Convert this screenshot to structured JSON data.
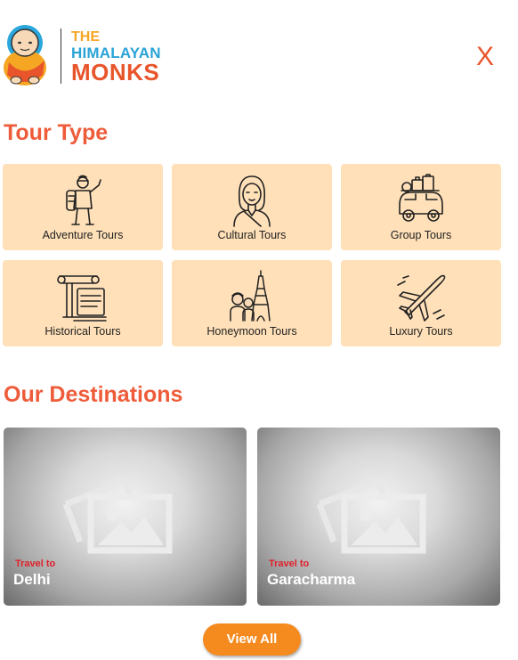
{
  "header": {
    "logo": {
      "line1": "THE",
      "line2": "HIMALAYAN",
      "line3": "MONKS"
    },
    "close_label": "X"
  },
  "tour_type": {
    "title": "Tour Type",
    "items": [
      {
        "label": "Adventure Tours",
        "icon": "hiker-icon"
      },
      {
        "label": "Cultural Tours",
        "icon": "woman-portrait-icon"
      },
      {
        "label": "Group Tours",
        "icon": "car-luggage-icon"
      },
      {
        "label": "Historical Tours",
        "icon": "scroll-column-icon"
      },
      {
        "label": "Honeymoon Tours",
        "icon": "couple-eiffel-icon"
      },
      {
        "label": "Luxury Tours",
        "icon": "airplane-icon"
      }
    ]
  },
  "destinations": {
    "title": "Our Destinations",
    "items": [
      {
        "prefix": "Travel to",
        "name": "Delhi"
      },
      {
        "prefix": "Travel to",
        "name": "Garacharma"
      }
    ],
    "view_all_label": "View All"
  },
  "colors": {
    "accent": "#ee5c3a",
    "card_bg": "#ffe0b8",
    "button": "#f58a1f",
    "travel_to": "#e0202a"
  }
}
